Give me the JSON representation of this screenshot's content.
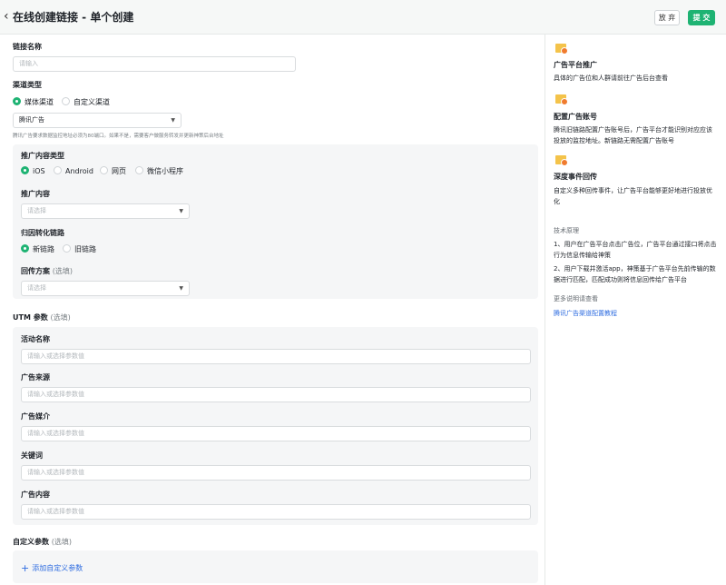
{
  "header": {
    "back_icon": "chevron-left-icon",
    "title": "在线创建链接 - 单个创建",
    "cancel_label": "放 弃",
    "submit_label": "提 交",
    "accent": "#1eb373"
  },
  "form": {
    "link_name": {
      "label": "链接名称",
      "placeholder": "请输入"
    },
    "channel_type": {
      "label": "渠道类型",
      "options": [
        "媒体渠道",
        "自定义渠道"
      ],
      "selected": "媒体渠道"
    },
    "channel_select": {
      "value": "腾讯广告"
    },
    "hint": "腾讯广告要求数据监控地址必须为80端口。如果不是，需要客户做服务转发并更新神策后台地址",
    "promo_type": {
      "label": "推广内容类型",
      "options": [
        "iOS",
        "Android",
        "网页",
        "微信小程序"
      ],
      "selected": "iOS"
    },
    "promo_content": {
      "label": "推广内容",
      "placeholder": "请选择"
    },
    "attribution": {
      "label": "归因转化链路",
      "options": [
        "新链路",
        "旧链路"
      ],
      "selected": "新链路"
    },
    "callback": {
      "label": "回传方案",
      "optional": "(选填)",
      "placeholder": "请选择"
    }
  },
  "utm": {
    "label": "UTM 参数",
    "optional": "(选填)",
    "fields": [
      {
        "label": "活动名称",
        "placeholder": "请输入或选择参数值"
      },
      {
        "label": "广告来源",
        "placeholder": "请输入或选择参数值"
      },
      {
        "label": "广告媒介",
        "placeholder": "请输入或选择参数值"
      },
      {
        "label": "关键词",
        "placeholder": "请输入或选择参数值"
      },
      {
        "label": "广告内容",
        "placeholder": "请输入或选择参数值"
      }
    ]
  },
  "custom": {
    "label": "自定义参数",
    "optional": "(选填)",
    "add_label": "添加自定义参数"
  },
  "sidebar": {
    "sections": [
      {
        "title": "广告平台推广",
        "text": "具体的广告位和人群请前往广告后台查看"
      },
      {
        "title": "配置广告账号",
        "text": "腾讯旧链路配置广告账号后，广告平台才能识别对应应该投放的监控地址。新链路无需配置广告账号"
      },
      {
        "title": "深度事件回传",
        "text": "自定义多种回传事件，让广告平台能够更好地进行投放优化"
      }
    ],
    "tech_title": "技术原理",
    "tech_steps": [
      "1、用户在广告平台点击广告位，广告平台通过接口将点击行为信息传输给神策",
      "2、用户下载并激活app，神策基于广告平台先前传输的数据进行匹配，匹配成功则将信息回传给广告平台"
    ],
    "more_label": "更多说明请查看",
    "link_label": "腾讯广告渠道配置教程"
  }
}
